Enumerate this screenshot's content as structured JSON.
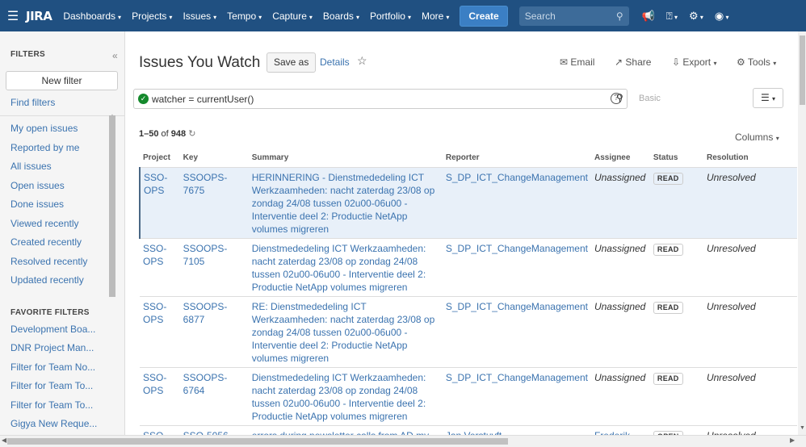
{
  "nav": {
    "logo": "JIRA",
    "menu": [
      "Dashboards",
      "Projects",
      "Issues",
      "Tempo",
      "Capture",
      "Boards",
      "Portfolio",
      "More"
    ],
    "create": "Create",
    "search_placeholder": "Search"
  },
  "sidebar": {
    "filters_heading": "FILTERS",
    "new_filter": "New filter",
    "find_filters": "Find filters",
    "items": [
      "My open issues",
      "Reported by me",
      "All issues",
      "Open issues",
      "Done issues",
      "Viewed recently",
      "Created recently",
      "Resolved recently",
      "Updated recently"
    ],
    "favorites_heading": "FAVORITE FILTERS",
    "favorites": [
      "Development Boa...",
      "DNR Project Man...",
      "Filter for Team No...",
      "Filter for Team To...",
      "Filter for Team To...",
      "Gigya New Reque..."
    ]
  },
  "main": {
    "title": "Issues You Watch",
    "save_as": "Save as",
    "details": "Details",
    "email": "Email",
    "share": "Share",
    "export": "Export",
    "tools": "Tools",
    "query": "watcher = currentUser()",
    "basic": "Basic",
    "count_range": "1–50",
    "count_of": "of",
    "count_total": "948",
    "columns": "Columns"
  },
  "table": {
    "headers": [
      "Project",
      "Key",
      "Summary",
      "Reporter",
      "Assignee",
      "Status",
      "Resolution"
    ],
    "rows": [
      {
        "project": "SSO-OPS",
        "key": "SSOOPS-7675",
        "summary": "HERINNERING - Dienstmededeling ICT Werkzaamheden: nacht zaterdag 23/08 op zondag 24/08 tussen 02u00-06u00 - Interventie deel 2: Productie NetApp volumes migreren",
        "reporter": "S_DP_ICT_ChangeManagement",
        "assignee": "Unassigned",
        "status": "READ",
        "resolution": "Unresolved"
      },
      {
        "project": "SSO-OPS",
        "key": "SSOOPS-7105",
        "summary": "Dienstmededeling ICT Werkzaamheden: nacht zaterdag 23/08 op zondag 24/08 tussen 02u00-06u00 - Interventie deel 2: Productie NetApp volumes migreren",
        "reporter": "S_DP_ICT_ChangeManagement",
        "assignee": "Unassigned",
        "status": "READ",
        "resolution": "Unresolved"
      },
      {
        "project": "SSO-OPS",
        "key": "SSOOPS-6877",
        "summary": "RE: Dienstmededeling ICT Werkzaamheden: nacht zaterdag 23/08 op zondag 24/08 tussen 02u00-06u00 - Interventie deel 2: Productie NetApp volumes migreren",
        "reporter": "S_DP_ICT_ChangeManagement",
        "assignee": "Unassigned",
        "status": "READ",
        "resolution": "Unresolved"
      },
      {
        "project": "SSO-OPS",
        "key": "SSOOPS-6764",
        "summary": "Dienstmededeling ICT Werkzaamheden: nacht zaterdag 23/08 op zondag 24/08 tussen 02u00-06u00 - Interventie deel 2: Productie NetApp volumes migreren",
        "reporter": "S_DP_ICT_ChangeManagement",
        "assignee": "Unassigned",
        "status": "READ",
        "resolution": "Unresolved"
      },
      {
        "project": "SSO",
        "key": "SSO-5056",
        "summary": "errors during newsletter calls from AD my account",
        "reporter": "Jan Verstuyft",
        "assignee": "Frederik Bracke",
        "status": "OPEN",
        "resolution": "Unresolved"
      }
    ]
  }
}
